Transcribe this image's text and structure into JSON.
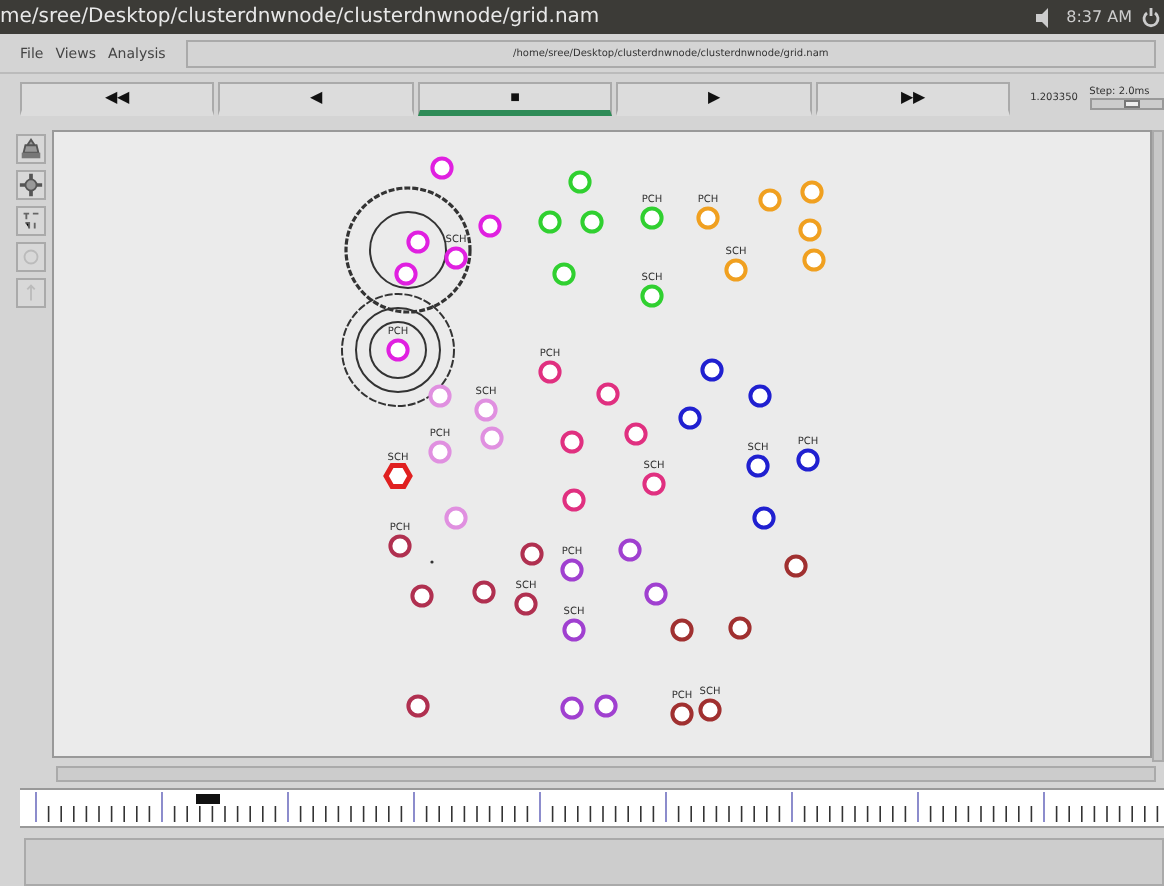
{
  "window": {
    "title": "me/sree/Desktop/clusterdnwnode/clusterdnwnode/grid.nam",
    "clock": "8:37 AM"
  },
  "menu": [
    "File",
    "Views",
    "Analysis"
  ],
  "file_path": "/home/sree/Desktop/clusterdnwnode/clusterdnwnode/grid.nam",
  "controls": [
    {
      "label": "◀◀",
      "selected": false
    },
    {
      "label": "◀",
      "selected": false
    },
    {
      "label": "■",
      "selected": true
    },
    {
      "label": "▶",
      "selected": false
    },
    {
      "label": "▶▶",
      "selected": false
    }
  ],
  "time": "1.203350",
  "step": {
    "label": "Step: 2.0ms",
    "level": 0.6
  },
  "nodes": [
    {
      "color": "#e020e0",
      "kind": "circle"
    },
    {
      "color": "#e020e0",
      "kind": "circle"
    },
    {
      "color": "#e020e0",
      "kind": "circle"
    },
    {
      "color": "#e020e0",
      "kind": "circle",
      "label": "SCH"
    },
    {
      "color": "#e020e0",
      "kind": "circle"
    },
    {
      "color": "#e020e0",
      "kind": "circle",
      "label": "PCH"
    },
    {
      "color": "#30d030",
      "kind": "circle"
    },
    {
      "color": "#30d030",
      "kind": "circle"
    },
    {
      "color": "#30d030",
      "kind": "circle"
    },
    {
      "color": "#30d030",
      "kind": "circle",
      "label": "PCH"
    },
    {
      "color": "#30d030",
      "kind": "circle"
    },
    {
      "color": "#30d030",
      "kind": "circle",
      "label": "SCH"
    },
    {
      "color": "#f0a020",
      "kind": "circle",
      "label": "PCH"
    },
    {
      "color": "#f0a020",
      "kind": "circle"
    },
    {
      "color": "#f0a020",
      "kind": "circle"
    },
    {
      "color": "#f0a020",
      "kind": "circle"
    },
    {
      "color": "#f0a020",
      "kind": "circle"
    },
    {
      "color": "#f0a020",
      "kind": "circle",
      "label": "SCH"
    },
    {
      "color": "#e03080",
      "kind": "circle",
      "label": "PCH"
    },
    {
      "color": "#e03080",
      "kind": "circle"
    },
    {
      "color": "#e090e0",
      "kind": "circle"
    },
    {
      "color": "#e090e0",
      "kind": "circle",
      "label": "SCH"
    },
    {
      "color": "#e090e0",
      "kind": "circle"
    },
    {
      "color": "#e090e0",
      "kind": "circle",
      "label": "PCH"
    },
    {
      "color": "#e02020",
      "kind": "hexagon",
      "label": "SCH"
    },
    {
      "color": "#e03080",
      "kind": "circle"
    },
    {
      "color": "#e03080",
      "kind": "circle"
    },
    {
      "color": "#e03080",
      "kind": "circle",
      "label": "SCH"
    },
    {
      "color": "#e03080",
      "kind": "circle"
    },
    {
      "color": "#e090e0",
      "kind": "circle"
    },
    {
      "color": "#2020d0",
      "kind": "circle"
    },
    {
      "color": "#2020d0",
      "kind": "circle"
    },
    {
      "color": "#2020d0",
      "kind": "circle"
    },
    {
      "color": "#2020d0",
      "kind": "circle",
      "label": "SCH"
    },
    {
      "color": "#2020d0",
      "kind": "circle",
      "label": "PCH"
    },
    {
      "color": "#2020d0",
      "kind": "circle"
    },
    {
      "color": "#b03050",
      "kind": "circle",
      "label": "PCH"
    },
    {
      "color": "#b03050",
      "kind": "circle"
    },
    {
      "color": "#a040d0",
      "kind": "circle",
      "label": "PCH"
    },
    {
      "color": "#a040d0",
      "kind": "circle"
    },
    {
      "color": "#b03050",
      "kind": "circle"
    },
    {
      "color": "#b03050",
      "kind": "circle"
    },
    {
      "color": "#b03050",
      "kind": "circle",
      "label": "SCH"
    },
    {
      "color": "#a040d0",
      "kind": "circle"
    },
    {
      "color": "#a040d0",
      "kind": "circle",
      "label": "SCH"
    },
    {
      "color": "#a03030",
      "kind": "circle"
    },
    {
      "color": "#a03030",
      "kind": "circle"
    },
    {
      "color": "#a03030",
      "kind": "circle"
    },
    {
      "color": "#b03050",
      "kind": "circle"
    },
    {
      "color": "#a040d0",
      "kind": "circle"
    },
    {
      "color": "#a040d0",
      "kind": "circle"
    },
    {
      "color": "#a03030",
      "kind": "circle",
      "label": "PCH"
    },
    {
      "color": "#a03030",
      "kind": "circle",
      "label": "SCH"
    }
  ]
}
